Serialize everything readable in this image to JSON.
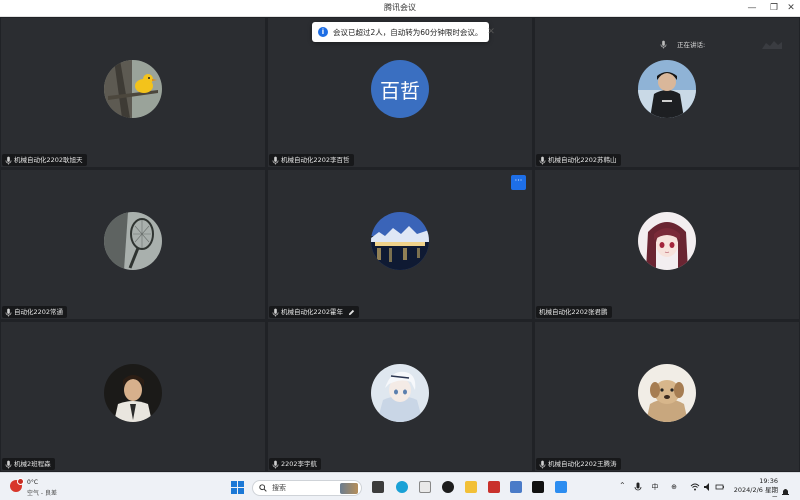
{
  "window": {
    "title": "腾讯会议",
    "controls": {
      "minimize": "—",
      "restore": "❐",
      "close": "✕"
    }
  },
  "toast": {
    "message": "会议已超过2人，自动转为60分钟限时会议。",
    "close_label": "✕",
    "icon": "info-icon"
  },
  "speaking": {
    "label": "正在讲话:"
  },
  "more_button": {
    "label": "···"
  },
  "participants": [
    {
      "name": "机械自动化2202耿旭天",
      "avatar": "duck-on-tree",
      "pen": false
    },
    {
      "name": "机械自动化2202李百哲",
      "avatar": "text",
      "avatar_text": "百哲",
      "avatar_color": "#3a6fc1",
      "pen": false
    },
    {
      "name": "机械自动化2202苏韩山",
      "avatar": "person-hoodie",
      "pen": false
    },
    {
      "name": "自动化2202常通",
      "avatar": "tennis-racket",
      "pen": false
    },
    {
      "name": "机械自动化2202霍年",
      "avatar": "night-city",
      "pen": true
    },
    {
      "name": "机械自动化2202张君鹏",
      "avatar": "anime-girl",
      "pen": false,
      "mic": false
    },
    {
      "name": "机械2班程森",
      "avatar": "boy-portrait",
      "pen": false
    },
    {
      "name": "2202李宇航",
      "avatar": "anime-boy",
      "pen": false
    },
    {
      "name": "机械自动化2202王腾涛",
      "avatar": "dog",
      "pen": false
    }
  ],
  "taskbar": {
    "weather": {
      "temp": "0°C",
      "status": "空气 - 良差",
      "badge": ""
    },
    "search_placeholder": "搜索",
    "apps": [
      "file-explorer-icon",
      "edge-icon",
      "dell-icon",
      "folder-icon",
      "store-icon",
      "mcafee-icon",
      "shield-app-icon",
      "tiktok-icon",
      "meeting-icon"
    ],
    "tray": {
      "lang": "中",
      "time": "19:36",
      "date": "2024/2/6 星期二"
    }
  },
  "colors": {
    "accent": "#1e6fe8",
    "stage_bg": "#202226",
    "tile_bg": "#2b2d31"
  }
}
